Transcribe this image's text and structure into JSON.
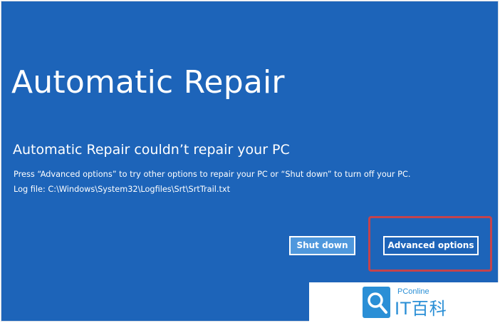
{
  "screen": {
    "title": "Automatic Repair",
    "subtitle": "Automatic Repair couldn’t repair your PC",
    "description": "Press “Advanced options” to try other options to repair your PC or “Shut down” to turn off your PC.",
    "log_file": "Log file: C:\\Windows\\System32\\Logfiles\\Srt\\SrtTrail.txt"
  },
  "buttons": {
    "shutdown_label": "Shut down",
    "advanced_label": "Advanced options"
  },
  "watermark": {
    "brand_small": "PConline",
    "brand_big": "IT百科",
    "logo_icon": "magnifier-logo-icon"
  },
  "colors": {
    "background": "#1d64b9",
    "shutdown_button": "#4f98dd",
    "highlight": "#c4434c",
    "watermark": "#2a8fd6"
  }
}
